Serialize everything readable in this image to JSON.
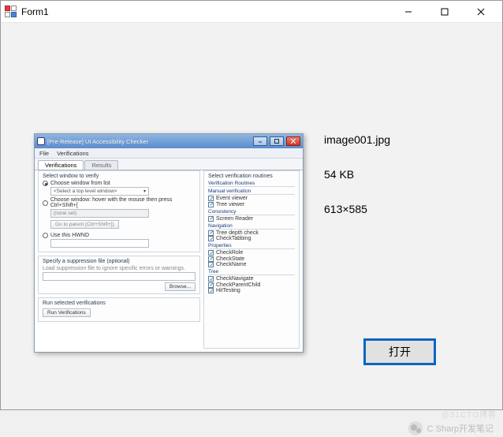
{
  "outer": {
    "title": "Form1"
  },
  "info": {
    "filename": "image001.jpg",
    "size": "54 KB",
    "dims": "613×585"
  },
  "open_btn_label": "打开",
  "inner": {
    "title": "[Pre-Release] UI Accessibility Checker",
    "menu": {
      "file": "File",
      "verifications": "Verifications"
    },
    "tabs": {
      "active": "Verifications",
      "inactive": "Results"
    },
    "left": {
      "select_window": "Select window to verify",
      "from_list": "Choose window from list",
      "combo_placeholder": "<Select a top level window>",
      "hover": "Choose window: hover with the mouse then press Ctrl+Shift+[",
      "none_set": "(none set)",
      "go_parent": "Go to parent (Ctrl+Shift+])",
      "use_hwnd": "Use this HWND",
      "supp_hdr": "Specify a suppression file (optional)",
      "supp_text": "Load suppression file to ignore specific errors or warnings.",
      "browse": "Browse...",
      "run_hdr": "Run selected verifications",
      "run_btn": "Run Verifications"
    },
    "right": {
      "hdr": "Select verification routines",
      "sections": {
        "vr": "Verification Routines",
        "manual": "Manual verification",
        "consistency": "Consistency",
        "navigation": "Navigation",
        "properties": "Properties",
        "tree": "Tree"
      },
      "items": {
        "event": "Event viewer",
        "treev": "Tree viewer",
        "screen": "Screen Reader",
        "depth": "Tree depth check",
        "tabbing": "CheckTabbing",
        "role": "CheckRole",
        "state": "CheckState",
        "name": "CheckName",
        "nav": "CheckNavigate",
        "pc": "CheckParentChild",
        "ht": "HitTesting"
      }
    }
  },
  "watermark": {
    "wechat": "C Sharp开发笔记",
    "corner": "@51CTO博客"
  }
}
